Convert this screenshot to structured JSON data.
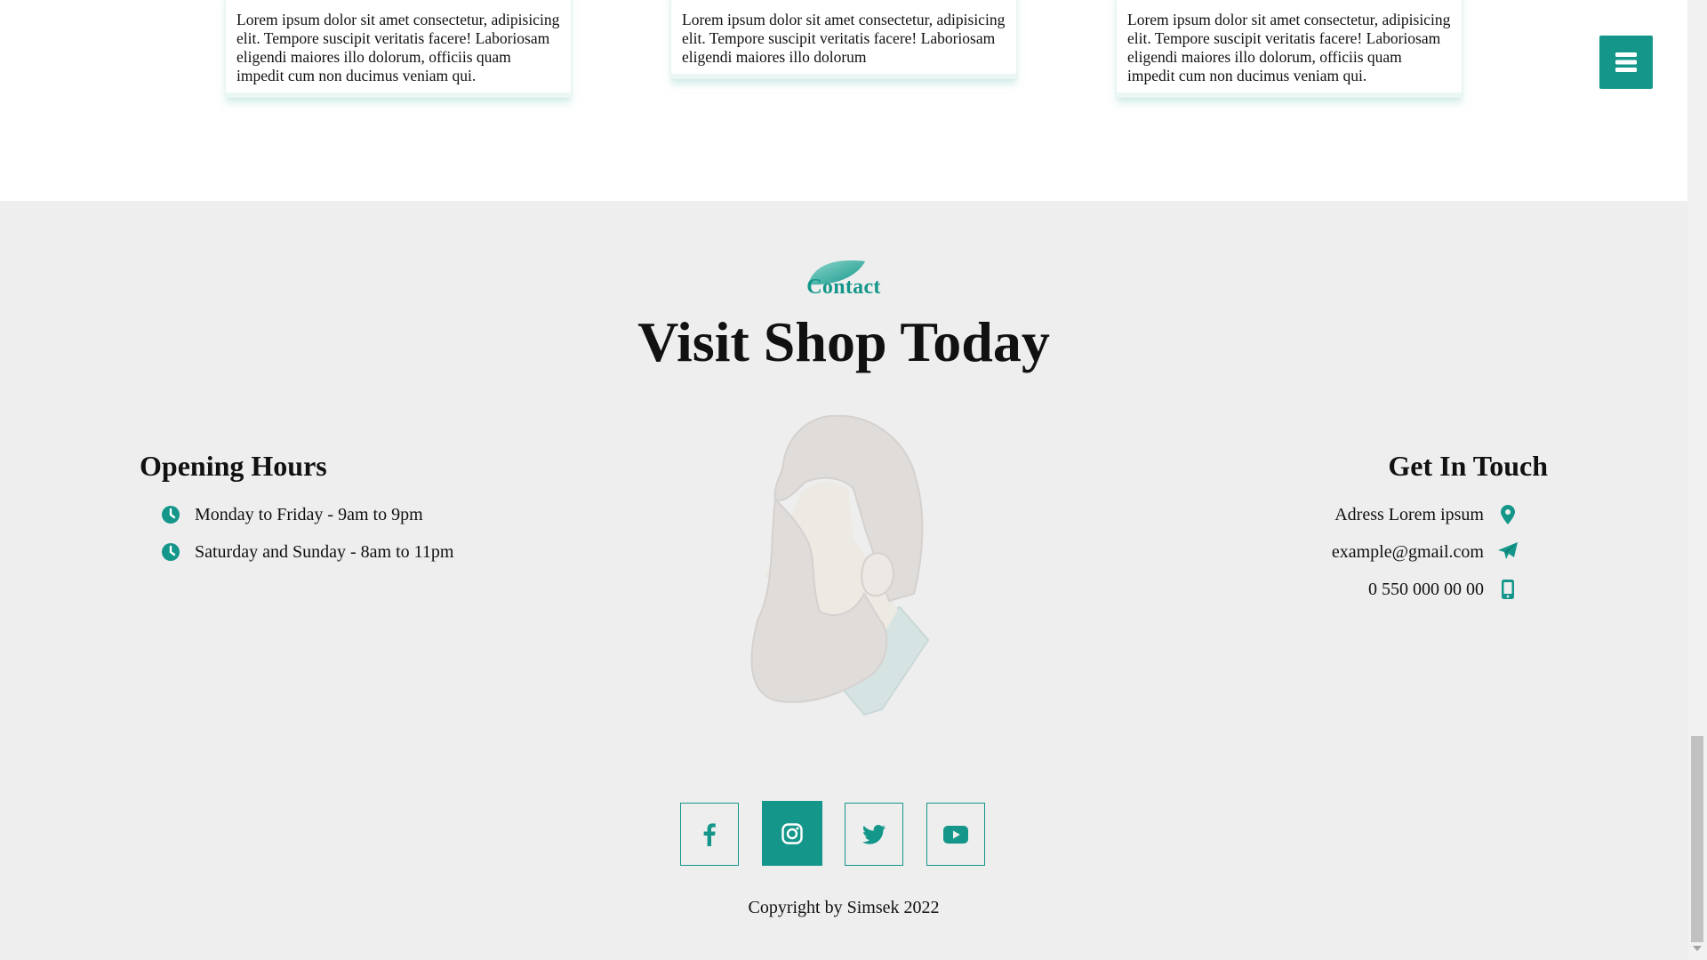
{
  "cards": [
    {
      "text": "Lorem ipsum dolor sit amet consectetur, adipisicing elit. Tempore suscipit veritatis facere! Laboriosam eligendi maiores illo dolorum, officiis quam impedit cum non ducimus veniam qui."
    },
    {
      "text": "Lorem ipsum dolor sit amet consectetur, adipisicing elit. Tempore suscipit veritatis facere! Laboriosam eligendi maiores illo dolorum"
    },
    {
      "text": "Lorem ipsum dolor sit amet consectetur, adipisicing elit. Tempore suscipit veritatis facere! Laboriosam eligendi maiores illo dolorum, officiis quam impedit cum non ducimus veniam qui."
    }
  ],
  "menu": {
    "icon": "hamburger-menu-icon"
  },
  "contact": {
    "kicker": "Contact",
    "heading": "Visit Shop Today",
    "opening_hours": {
      "title": "Opening Hours",
      "items": [
        {
          "icon": "clock-icon",
          "text": "Monday to Friday - 9am to 9pm"
        },
        {
          "icon": "clock-icon",
          "text": "Saturday and Sunday - 8am to 11pm"
        }
      ]
    },
    "get_in_touch": {
      "title": "Get In Touch",
      "items": [
        {
          "icon": "location-pin-icon",
          "text": "Adress Lorem ipsum"
        },
        {
          "icon": "paper-plane-icon",
          "text": "example@gmail.com"
        },
        {
          "icon": "mobile-phone-icon",
          "text": "0 550 000 00 00"
        }
      ]
    },
    "socials": [
      {
        "icon": "facebook-icon"
      },
      {
        "icon": "instagram-icon"
      },
      {
        "icon": "twitter-icon"
      },
      {
        "icon": "youtube-icon"
      }
    ],
    "copyright": "Copyright by Simsek 2022"
  },
  "colors": {
    "accent": "#14978a",
    "section_bg": "#eeeeee",
    "page_bg": "#ffffff"
  }
}
